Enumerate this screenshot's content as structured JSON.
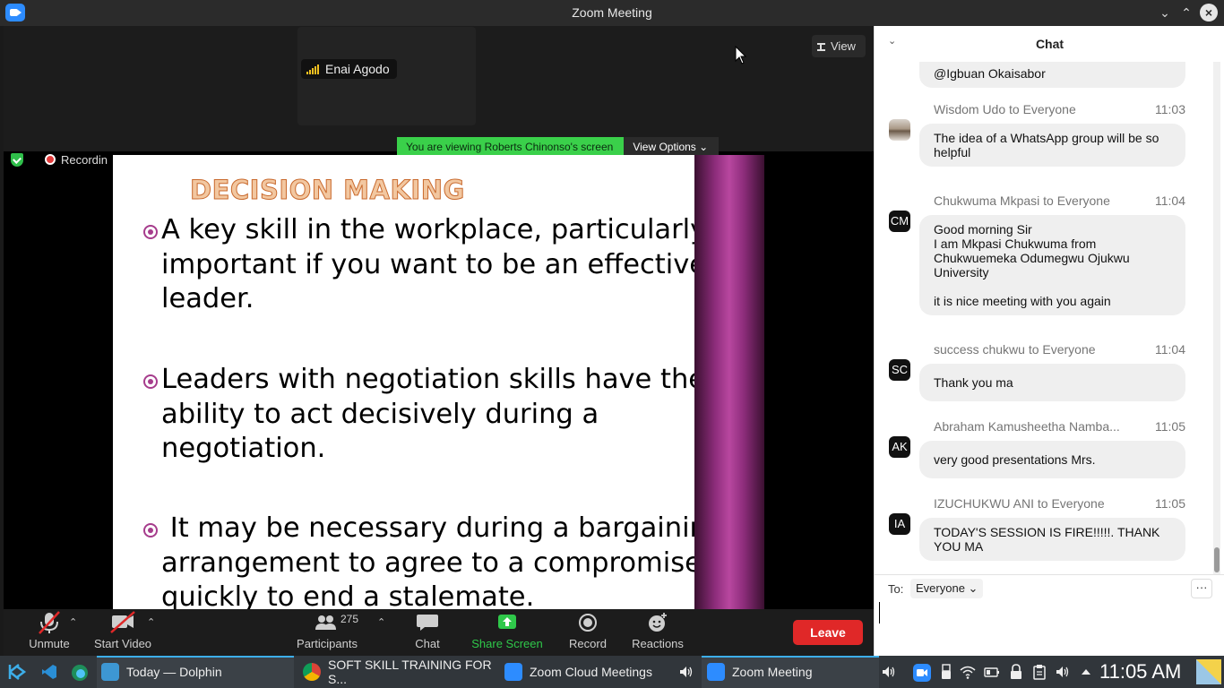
{
  "window": {
    "title": "Zoom Meeting"
  },
  "meeting": {
    "participant_tile_name": "Enai Agodo",
    "view_button": "View",
    "share_banner": "You are viewing Roberts Chinonso's screen",
    "view_options": "View Options",
    "recording_label": "Recordin"
  },
  "slide": {
    "title": "DECISION MAKING",
    "bullets": [
      "A key skill in the workplace, particularly\nimportant if you want to be an effective\nleader.",
      "Leaders with negotiation skills have the\nability to act decisively during a\nnegotiation.",
      " It may be necessary during a bargaining\narrangement to agree to a compromise\nquickly to end a stalemate."
    ],
    "accent_color": "#a63c8c"
  },
  "toolbar": {
    "unmute": "Unmute",
    "start_video": "Start Video",
    "participants_count": "275",
    "participants": "Participants",
    "chat": "Chat",
    "share_screen": "Share Screen",
    "record": "Record",
    "reactions": "Reactions",
    "leave": "Leave",
    "leave_color": "#e02828",
    "share_color": "#2fc84a"
  },
  "chat": {
    "title": "Chat",
    "partial_message": "@Igbuan Okaisabor",
    "messages": [
      {
        "sender": "Wisdom Udo to Everyone",
        "time": "11:03",
        "initials": "",
        "text": "The idea of a WhatsApp group will be so helpful"
      },
      {
        "sender": "Chukwuma Mkpasi to Everyone",
        "time": "11:04",
        "initials": "CM",
        "text": "Good morning Sir\nI am Mkpasi Chukwuma from Chukwuemeka Odumegwu Ojukwu University\n\nit is nice meeting with you again"
      },
      {
        "sender": "success chukwu to Everyone",
        "time": "11:04",
        "initials": "SC",
        "text": "Thank you ma"
      },
      {
        "sender": "Abraham Kamusheetha Namba...",
        "time": "11:05",
        "initials": "AK",
        "text": "very good presentations Mrs."
      },
      {
        "sender": "IZUCHUKWU ANI to Everyone",
        "time": "11:05",
        "initials": "IA",
        "text": "TODAY'S SESSION IS FIRE!!!!!. THANK YOU MA"
      }
    ],
    "to_label": "To:",
    "to_value": "Everyone",
    "more": "···",
    "input_value": ""
  },
  "taskbar": {
    "tasks": [
      {
        "label": "Today — Dolphin"
      },
      {
        "label": "SOFT SKILL TRAINING FOR S..."
      },
      {
        "label": "Zoom Cloud Meetings"
      },
      {
        "label": "Zoom Meeting"
      }
    ],
    "clock": "11:05 AM"
  }
}
